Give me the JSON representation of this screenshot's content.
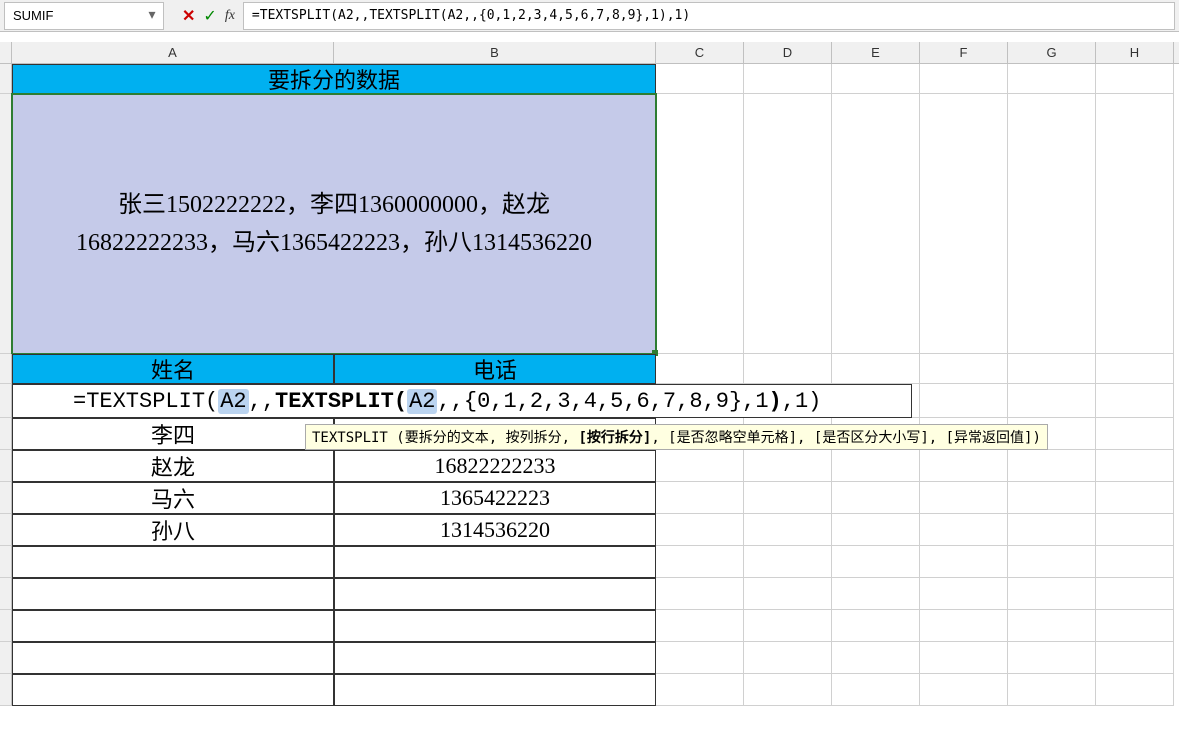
{
  "name_box": "SUMIF",
  "formula_bar": "=TEXTSPLIT(A2,,TEXTSPLIT(A2,,{0,1,2,3,4,5,6,7,8,9},1),1)",
  "columns": [
    "A",
    "B",
    "C",
    "D",
    "E",
    "F",
    "G",
    "H"
  ],
  "header_title": "要拆分的数据",
  "big_data_line1": "张三1502222222，李四1360000000，赵龙",
  "big_data_line2": "16822222233，马六1365422223，孙八1314536220",
  "sub_headers": {
    "name": "姓名",
    "phone": "电话"
  },
  "formula_edit": {
    "prefix": "=TEXTSPLIT(",
    "ref1": "A2",
    "sep1": ",,",
    "fn": "TEXTSPLIT",
    "open": "(",
    "ref2": "A2",
    "mid": ",,{0,1,2,",
    "mid2": "3,4,5,6,7,8,9},1",
    "close": ")",
    "suffix": ",1)"
  },
  "tooltip": {
    "fn": "TEXTSPLIT",
    "args_pre": "(要拆分的文本, 按列拆分, ",
    "arg_bold": "[按行拆分]",
    "args_post": ", [是否忽略空单元格], [是否区分大小写], [异常返回值])"
  },
  "result_rows": [
    {
      "name": "李四",
      "phone": ""
    },
    {
      "name": "赵龙",
      "phone": "16822222233"
    },
    {
      "name": "马六",
      "phone": "1365422223"
    },
    {
      "name": "孙八",
      "phone": "1314536220"
    }
  ]
}
